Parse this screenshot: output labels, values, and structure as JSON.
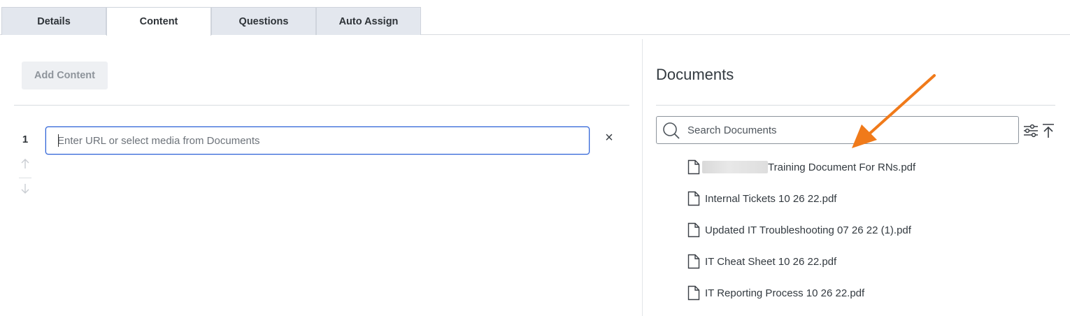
{
  "tabs": [
    {
      "label": "Details",
      "active": false
    },
    {
      "label": "Content",
      "active": true
    },
    {
      "label": "Questions",
      "active": false
    },
    {
      "label": "Auto Assign",
      "active": false
    }
  ],
  "content": {
    "add_button": "Add Content",
    "rows": [
      {
        "number": "1",
        "url_value": "",
        "url_placeholder": "Enter URL or select media from Documents",
        "clear_symbol": "×"
      }
    ]
  },
  "documents": {
    "title": "Documents",
    "search_placeholder": "Search Documents",
    "items": [
      {
        "name": "Training Document For RNs.pdf",
        "redacted_prefix": true
      },
      {
        "name": "Internal Tickets 10 26 22.pdf",
        "redacted_prefix": false
      },
      {
        "name": "Updated IT Troubleshooting 07 26 22 (1).pdf",
        "redacted_prefix": false
      },
      {
        "name": "IT Cheat Sheet 10 26 22.pdf",
        "redacted_prefix": false
      },
      {
        "name": "IT Reporting Process 10 26 22.pdf",
        "redacted_prefix": false
      }
    ]
  },
  "colors": {
    "accent_border": "#2a60d6",
    "annotation_arrow": "#f07a1a",
    "tab_inactive": "#e3e7ee"
  },
  "icons": [
    "search-icon",
    "filter-sliders-icon",
    "collapse-to-top-icon",
    "file-icon",
    "arrow-up-icon",
    "arrow-down-icon",
    "close-icon"
  ]
}
